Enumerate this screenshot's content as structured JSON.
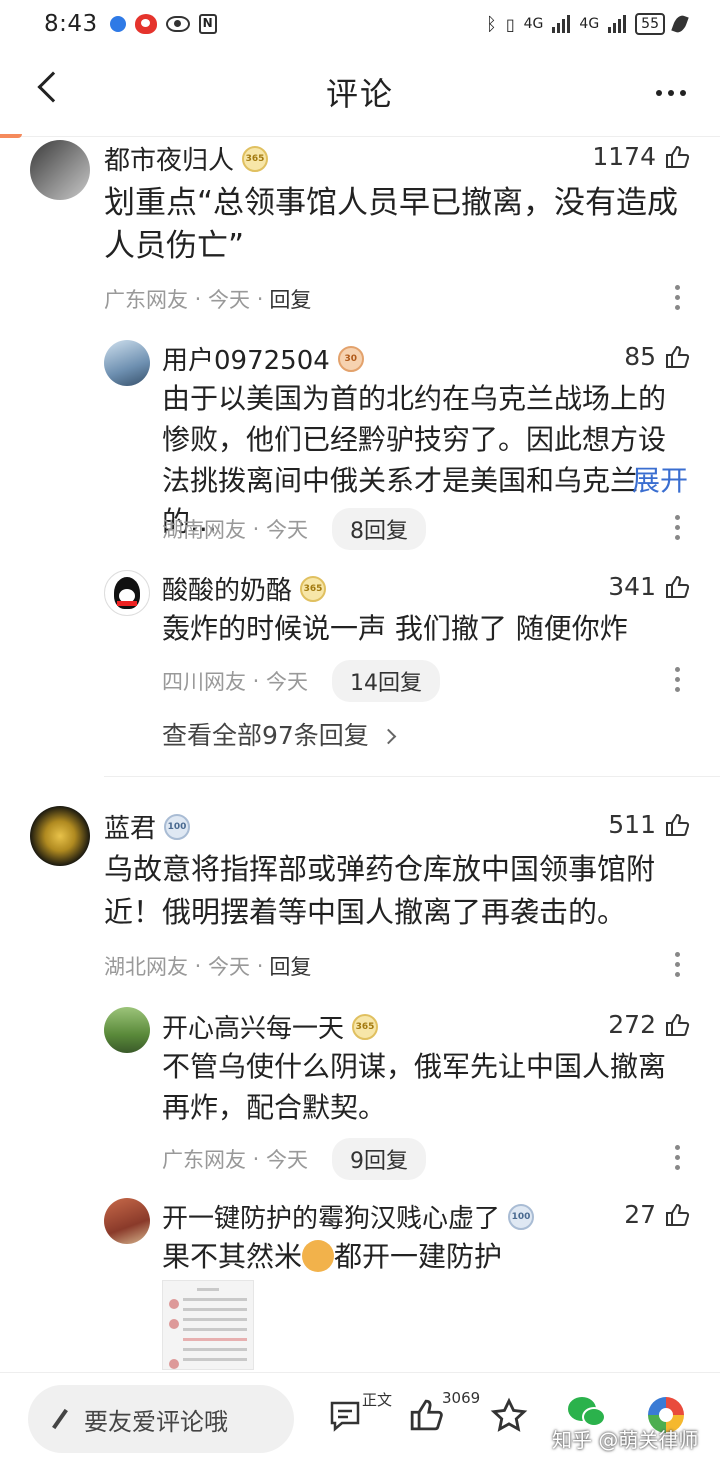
{
  "status_bar": {
    "time": "8:43",
    "signal_left": "4G",
    "signal_right": "4G",
    "battery": "55"
  },
  "nav": {
    "title": "评论"
  },
  "comments": [
    {
      "user": "都市夜归人",
      "badge": "365",
      "likes": "1174",
      "text": "划重点“总领事馆人员早已撤离，没有造成人员伤亡”",
      "region": "广东网友",
      "time": "今天",
      "reply_label": "回复",
      "replies": [
        {
          "user": "用户0972504",
          "badge": "30",
          "likes": "85",
          "text": "由于以美国为首的北约在乌克兰战场上的惨败，他们已经黔驴技穷了。因此想方设法挑拨离间中俄关系才是美国和乌克兰的...",
          "expand": "展开",
          "region": "湖南网友",
          "time": "今天",
          "reply_count": "8回复"
        },
        {
          "user": "酸酸的奶酪",
          "badge": "365",
          "likes": "341",
          "text": "轰炸的时候说一声 我们撤了 随便你炸",
          "region": "四川网友",
          "time": "今天",
          "reply_count": "14回复"
        }
      ],
      "view_all": "查看全部97条回复"
    },
    {
      "user": "蓝君",
      "badge": "100",
      "likes": "511",
      "text": "乌故意将指挥部或弹药仓库放中国领事馆附近！俄明摆着等中国人撤离了再袭击的。",
      "region": "湖北网友",
      "time": "今天",
      "reply_label": "回复",
      "replies": [
        {
          "user": "开心高兴每一天",
          "badge": "365",
          "likes": "272",
          "text": "不管乌使什么阴谋，俄军先让中国人撤离再炸，配合默契。",
          "region": "广东网友",
          "time": "今天",
          "reply_count": "9回复"
        },
        {
          "user": "开一键防护的霉狗汉贱心虚了",
          "badge": "100",
          "likes": "27",
          "text_a": "果不其然米",
          "text_b": "都开一建防护"
        }
      ]
    }
  ],
  "bottom_bar": {
    "input_placeholder": "要友爱评论哦",
    "article_label": "正文",
    "like_count": "3069"
  },
  "watermark": "知乎 @萌关律师"
}
